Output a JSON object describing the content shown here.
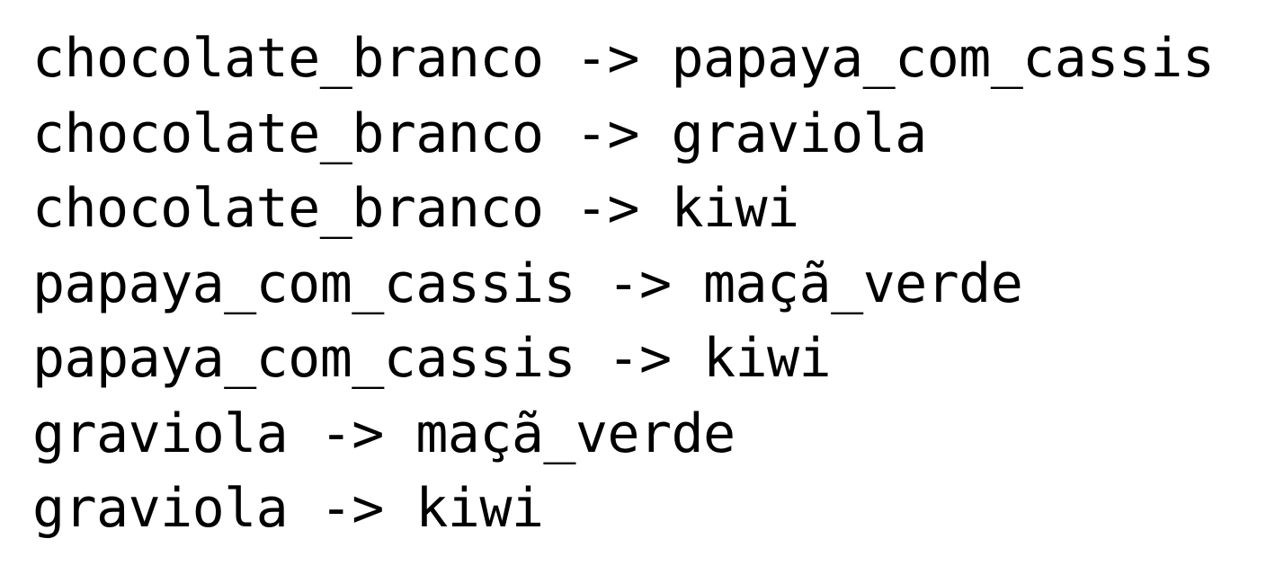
{
  "lines": [
    "chocolate_branco -> papaya_com_cassis",
    "chocolate_branco -> graviola",
    "chocolate_branco -> kiwi",
    "papaya_com_cassis -> maçã_verde",
    "papaya_com_cassis -> kiwi",
    "graviola -> maçã_verde",
    "graviola -> kiwi"
  ]
}
